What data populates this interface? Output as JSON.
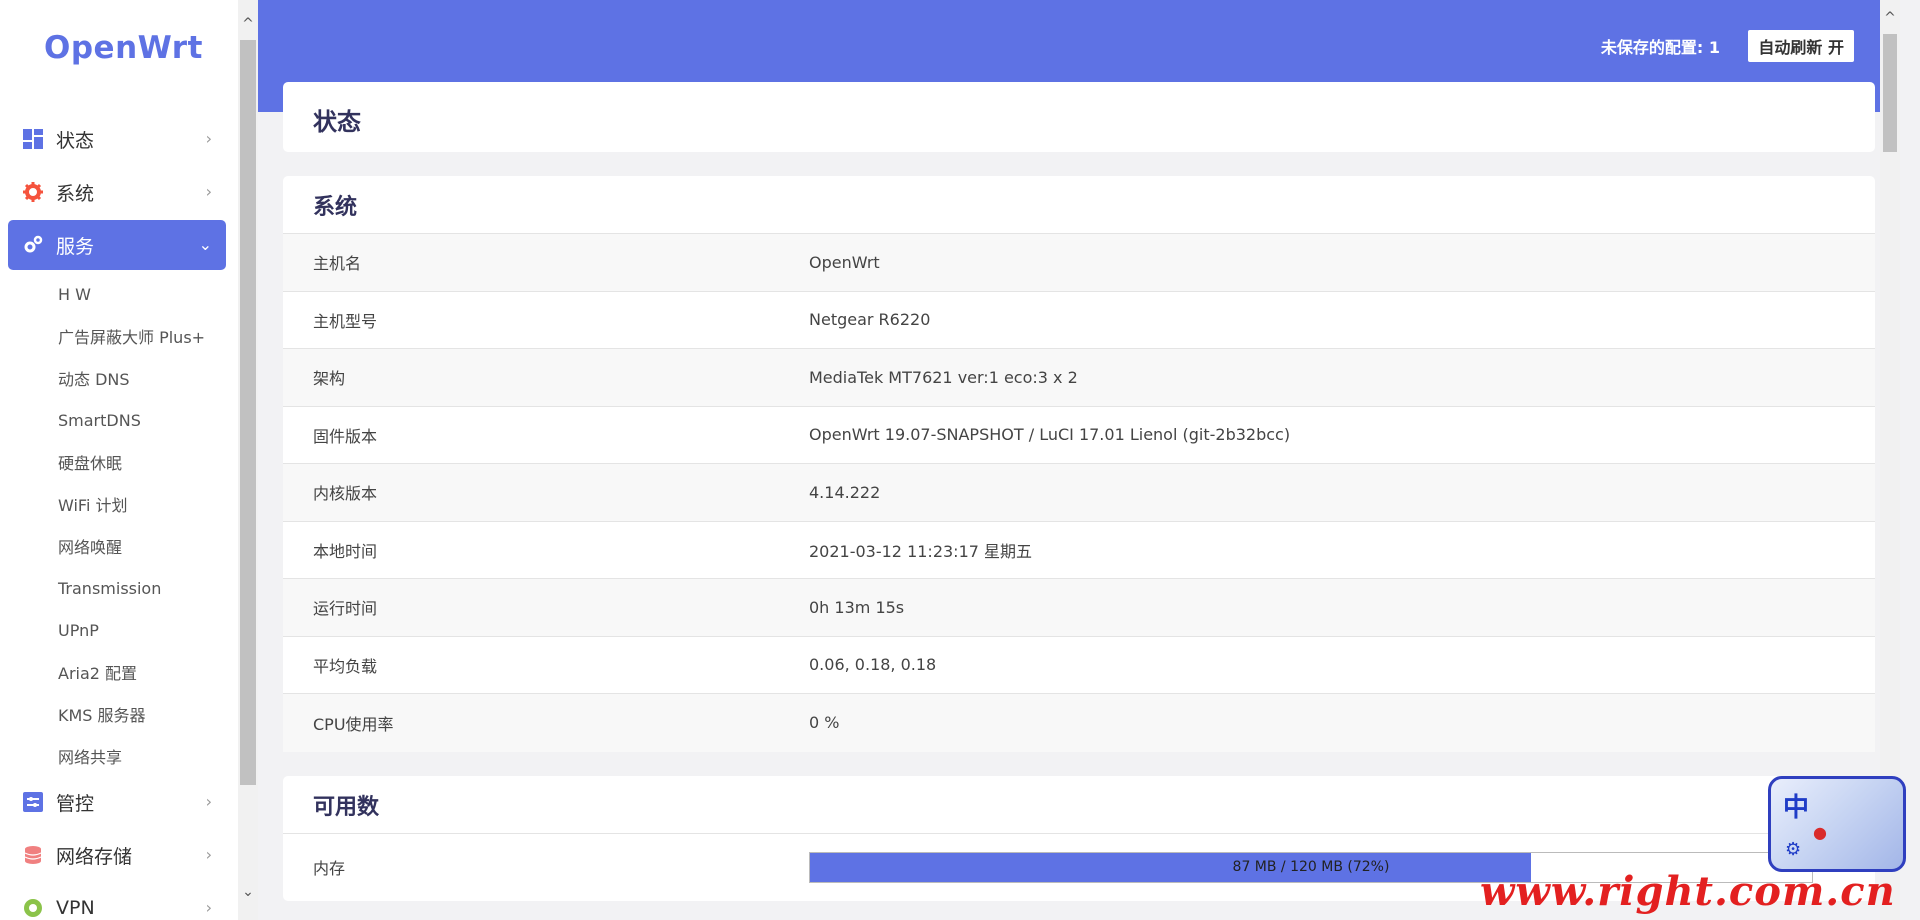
{
  "sidebar": {
    "logo": "OpenWrt",
    "menu": [
      {
        "label": "状态",
        "icon": "dashboard-icon"
      },
      {
        "label": "系统",
        "icon": "gear-icon"
      },
      {
        "label": "服务",
        "icon": "gears-icon",
        "active": true
      }
    ],
    "submenu": [
      "H     W",
      "广告屏蔽大师 Plus+",
      "动态 DNS",
      "SmartDNS",
      "硬盘休眠",
      "WiFi 计划",
      "网络唤醒",
      "Transmission",
      "UPnP",
      "Aria2 配置",
      "KMS 服务器",
      "网络共享"
    ],
    "menu_after": [
      {
        "label": "管控",
        "icon": "sliders-icon"
      },
      {
        "label": "网络存储",
        "icon": "database-icon"
      },
      {
        "label": "VPN",
        "icon": "vpn-icon"
      }
    ]
  },
  "header": {
    "unsaved": "未保存的配置: 1",
    "autorefresh": "自动刷新 开"
  },
  "page": {
    "title": "状态"
  },
  "system": {
    "title": "系统",
    "rows": [
      {
        "key": "主机名",
        "value": "OpenWrt"
      },
      {
        "key": "主机型号",
        "value": "Netgear R6220"
      },
      {
        "key": "架构",
        "value": "MediaTek MT7621 ver:1 eco:3 x 2"
      },
      {
        "key": "固件版本",
        "value": "OpenWrt 19.07-SNAPSHOT / LuCI 17.01 Lienol (git-2b32bcc)"
      },
      {
        "key": "内核版本",
        "value": "4.14.222"
      },
      {
        "key": "本地时间",
        "value": "2021-03-12 11:23:17 星期五"
      },
      {
        "key": "运行时间",
        "value": "0h 13m 15s"
      },
      {
        "key": "平均负载",
        "value": "0.06, 0.18, 0.18"
      },
      {
        "key": "CPU使用率",
        "value": "0 %"
      }
    ]
  },
  "available": {
    "title": "可用数",
    "memory_label": "内存",
    "memory_text": "87 MB / 120 MB (72%)",
    "memory_fraction": 0.72
  },
  "ime": {
    "label": "中"
  },
  "watermark": "www.right.com.cn",
  "colors": {
    "accent": "#5e72e4",
    "watermark": "#e32020"
  }
}
